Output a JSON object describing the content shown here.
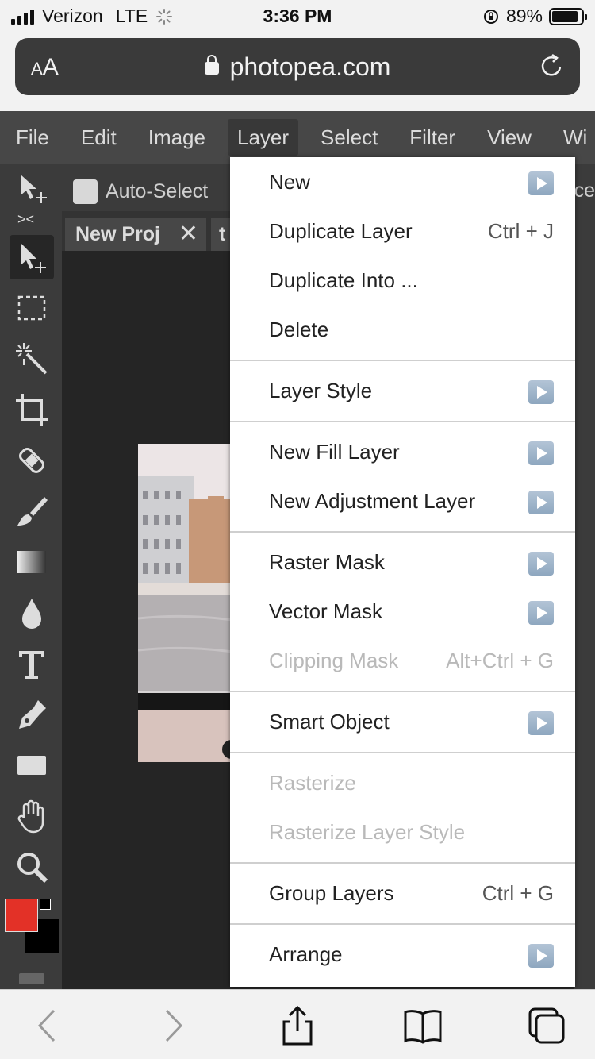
{
  "status_bar": {
    "carrier": "Verizon",
    "network": "LTE",
    "time": "3:36 PM",
    "battery": "89%",
    "battery_level": 0.89
  },
  "browser": {
    "text_size_label": "AA",
    "url": "photopea.com"
  },
  "menubar": {
    "items": [
      "File",
      "Edit",
      "Image",
      "Layer",
      "Select",
      "Filter",
      "View",
      "Wi"
    ],
    "active": "Layer"
  },
  "options": {
    "auto_select": "Auto-Select",
    "cut_text": "ace"
  },
  "tabs": [
    {
      "label": "New Proj",
      "close": "✕"
    },
    {
      "label": "t"
    }
  ],
  "layer_menu": {
    "groups": [
      [
        {
          "label": "New",
          "submenu": true
        },
        {
          "label": "Duplicate Layer",
          "shortcut": "Ctrl + J"
        },
        {
          "label": "Duplicate Into ..."
        },
        {
          "label": "Delete"
        }
      ],
      [
        {
          "label": "Layer Style",
          "submenu": true
        }
      ],
      [
        {
          "label": "New Fill Layer",
          "submenu": true
        },
        {
          "label": "New Adjustment Layer",
          "submenu": true
        }
      ],
      [
        {
          "label": "Raster Mask",
          "submenu": true
        },
        {
          "label": "Vector Mask",
          "submenu": true
        },
        {
          "label": "Clipping Mask",
          "shortcut": "Alt+Ctrl + G",
          "disabled": true
        }
      ],
      [
        {
          "label": "Smart Object",
          "submenu": true
        }
      ],
      [
        {
          "label": "Rasterize",
          "disabled": true
        },
        {
          "label": "Rasterize Layer Style",
          "disabled": true
        }
      ],
      [
        {
          "label": "Group Layers",
          "shortcut": "Ctrl + G"
        }
      ],
      [
        {
          "label": "Arrange",
          "submenu": true
        }
      ]
    ]
  },
  "colors": {
    "foreground": "#e33127",
    "background": "#000000",
    "menu_accent": "#9bb2c9"
  }
}
